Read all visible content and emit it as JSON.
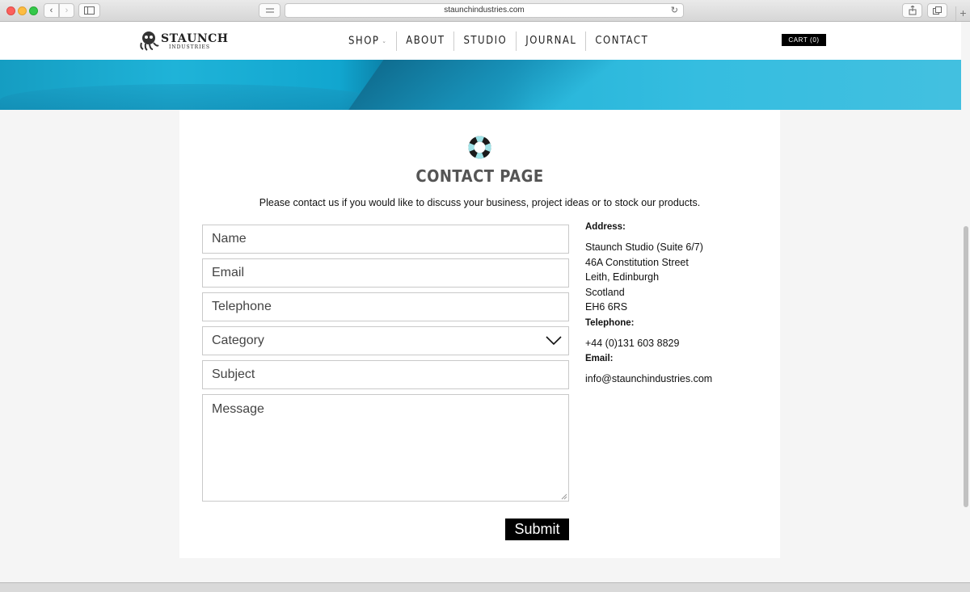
{
  "browser": {
    "url": "staunchindustries.com",
    "back_icon": "‹",
    "forward_icon": "›"
  },
  "header": {
    "logo_word": "STAUNCH",
    "logo_sub": "INDUSTRIES",
    "nav": [
      {
        "label": "SHOP",
        "has_dropdown": true
      },
      {
        "label": "ABOUT"
      },
      {
        "label": "STUDIO"
      },
      {
        "label": "JOURNAL"
      },
      {
        "label": "CONTACT"
      }
    ],
    "cart_label": "CART (0)"
  },
  "page": {
    "title": "CONTACT PAGE",
    "intro": "Please contact us if you would like to discuss your business, project ideas or to stock our products."
  },
  "form": {
    "name_placeholder": "Name",
    "email_placeholder": "Email",
    "telephone_placeholder": "Telephone",
    "category_selected": "Category",
    "subject_placeholder": "Subject",
    "message_placeholder": "Message",
    "submit_label": "Submit"
  },
  "contact_info": {
    "address_label": "Address:",
    "address_lines": [
      "Staunch Studio (Suite 6/7)",
      "46A Constitution Street",
      "Leith, Edinburgh",
      "Scotland",
      "EH6 6RS"
    ],
    "telephone_label": "Telephone:",
    "telephone": "+44 (0)131 603 8829",
    "email_label": "Email:",
    "email": "info@staunchindustries.com"
  },
  "colors": {
    "accent_teal": "#1fb3d8",
    "button_black": "#000000"
  }
}
